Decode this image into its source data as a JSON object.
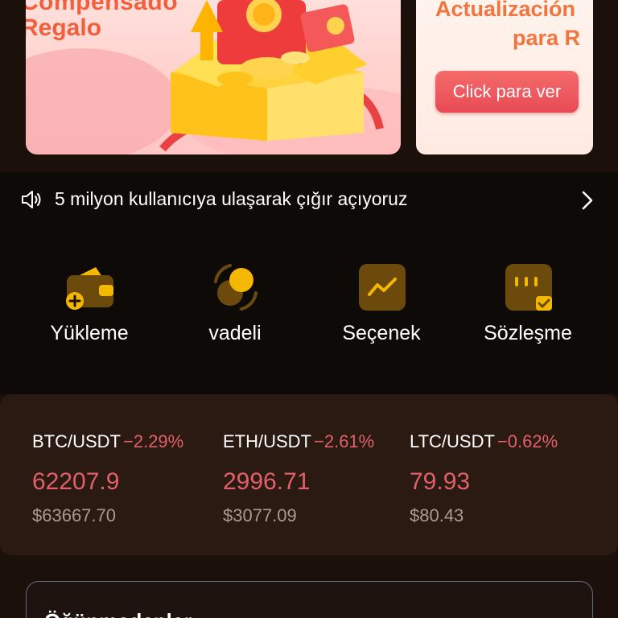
{
  "banners": {
    "main": {
      "line1": "Compensado",
      "line2": "Regalo"
    },
    "side": {
      "line1": "Actualización",
      "line2": "para R",
      "cta": "Click para ver"
    }
  },
  "notice": {
    "icon": "speaker-icon",
    "text": "5 milyon kullanıcıya ulaşarak çığır açıyoruz",
    "chevron_icon": "chevron-right-icon"
  },
  "actions": [
    {
      "label": "Yükleme",
      "icon": "wallet-plus-icon"
    },
    {
      "label": "vadeli",
      "icon": "exchange-coins-icon"
    },
    {
      "label": "Seçenek",
      "icon": "trend-chart-icon"
    },
    {
      "label": "Sözleşme",
      "icon": "contract-check-icon"
    }
  ],
  "ticker": [
    {
      "pair": "BTC/USDT",
      "change": "−2.29%",
      "price": "62207.9",
      "usd": "$63667.70"
    },
    {
      "pair": "ETH/USDT",
      "change": "−2.61%",
      "price": "2996.71",
      "usd": "$3077.09"
    },
    {
      "pair": "LTC/USDT",
      "change": "−0.62%",
      "price": "79.93",
      "usd": "$80.43"
    }
  ],
  "bottom": {
    "title": "Öğünmedenler"
  },
  "colors": {
    "background": "#1b100a",
    "accent": "#f5b800",
    "negative": "#e2606a",
    "muted": "#a89a92"
  }
}
